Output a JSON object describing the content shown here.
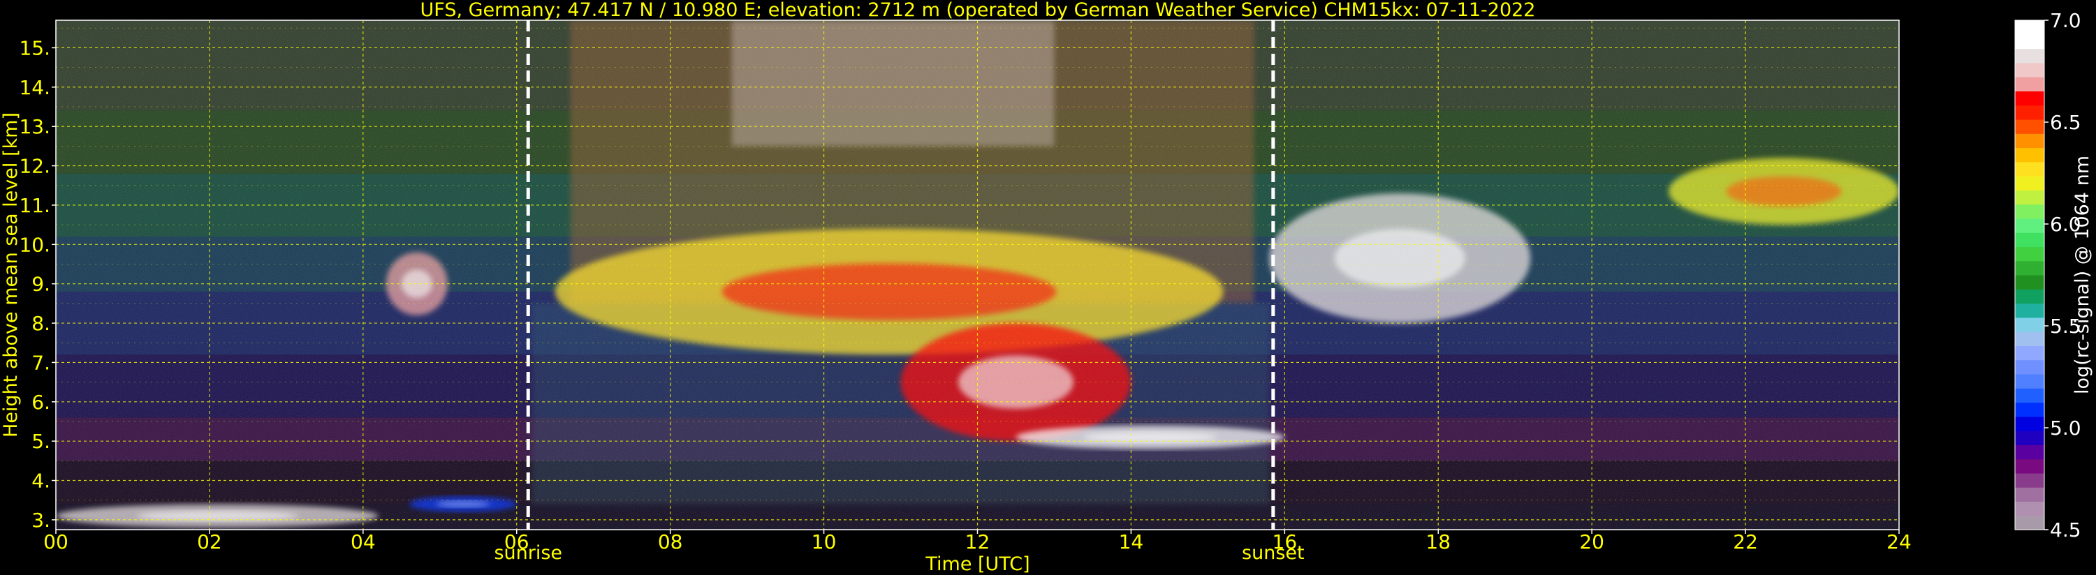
{
  "chart_data": {
    "type": "heatmap",
    "title": "UFS, Germany; 47.417 N / 10.980 E; elevation: 2712 m  (operated by German Weather Service)    CHM15kx: 07-11-2022",
    "xlabel": "Time [UTC]",
    "ylabel": "Height above mean sea level [km]",
    "xlim": [
      0,
      24
    ],
    "ylim": [
      2.75,
      15.7
    ],
    "x_ticks": [
      0,
      2,
      4,
      6,
      8,
      10,
      12,
      14,
      16,
      18,
      20,
      22,
      24
    ],
    "x_tick_labels": [
      "00",
      "02",
      "04",
      "06",
      "08",
      "10",
      "12",
      "14",
      "16",
      "18",
      "20",
      "22",
      "24"
    ],
    "y_ticks": [
      3,
      4,
      5,
      6,
      7,
      8,
      9,
      10,
      11,
      12,
      13,
      14,
      15
    ],
    "y_tick_labels": [
      "3.",
      "4.",
      "5.",
      "6.",
      "7.",
      "8.",
      "9.",
      "10.",
      "11.",
      "12.",
      "13.",
      "14.",
      "15."
    ],
    "grid": true,
    "markers": [
      {
        "label": "sunrise",
        "x": 6.15
      },
      {
        "label": "sunset",
        "x": 15.85
      }
    ],
    "colorbar": {
      "label": "log(rc-signal) @ 1064 nm",
      "min": 4.5,
      "max": 7.0,
      "ticks": [
        4.5,
        5.0,
        5.5,
        6.0,
        6.5,
        7.0
      ],
      "tick_labels": [
        "4.5",
        "5.0",
        "5.5",
        "6.0",
        "6.5",
        "7.0"
      ],
      "colors": [
        "#a89aa8",
        "#b090b0",
        "#a070a0",
        "#8a3c8c",
        "#7a0a80",
        "#5a00a0",
        "#2000c0",
        "#0000e0",
        "#0030ff",
        "#2060ff",
        "#5080ff",
        "#7090ff",
        "#90a8ff",
        "#a0c0f0",
        "#80d0e8",
        "#20b0a0",
        "#10a060",
        "#209020",
        "#30b030",
        "#40d040",
        "#40e060",
        "#60f080",
        "#80f060",
        "#c0f040",
        "#f0f020",
        "#ffe020",
        "#ffc000",
        "#ff9000",
        "#ff5000",
        "#ff2000",
        "#ff0000",
        "#f0a0a0",
        "#f0c8c8",
        "#e8e0e0",
        "#ffffff",
        "#ffffff"
      ]
    },
    "features": [
      {
        "name": "low cloud layer",
        "x": [
          0.0,
          4.2
        ],
        "y": [
          2.8,
          3.4
        ],
        "value": 6.8
      },
      {
        "name": "aerosol layer",
        "x": [
          4.6,
          6.0
        ],
        "y": [
          3.2,
          3.6
        ],
        "value": 5.1
      },
      {
        "name": "cloud patch",
        "x": [
          4.3,
          5.1
        ],
        "y": [
          8.2,
          9.8
        ],
        "value": 6.7
      },
      {
        "name": "cirrus cloud deck",
        "x": [
          6.5,
          15.2
        ],
        "y": [
          7.2,
          10.4
        ],
        "value": 6.3
      },
      {
        "name": "fall streaks",
        "x": [
          11.0,
          14.0
        ],
        "y": [
          5.0,
          8.0
        ],
        "value": 6.6
      },
      {
        "name": "lower cloud layer",
        "x": [
          12.5,
          16.0
        ],
        "y": [
          4.8,
          5.4
        ],
        "value": 6.9
      },
      {
        "name": "cirrus cloud",
        "x": [
          15.8,
          19.2
        ],
        "y": [
          8.0,
          11.3
        ],
        "value": 6.8
      },
      {
        "name": "thin cirrus",
        "x": [
          21.0,
          24.0
        ],
        "y": [
          10.5,
          12.2
        ],
        "value": 6.2
      }
    ]
  }
}
